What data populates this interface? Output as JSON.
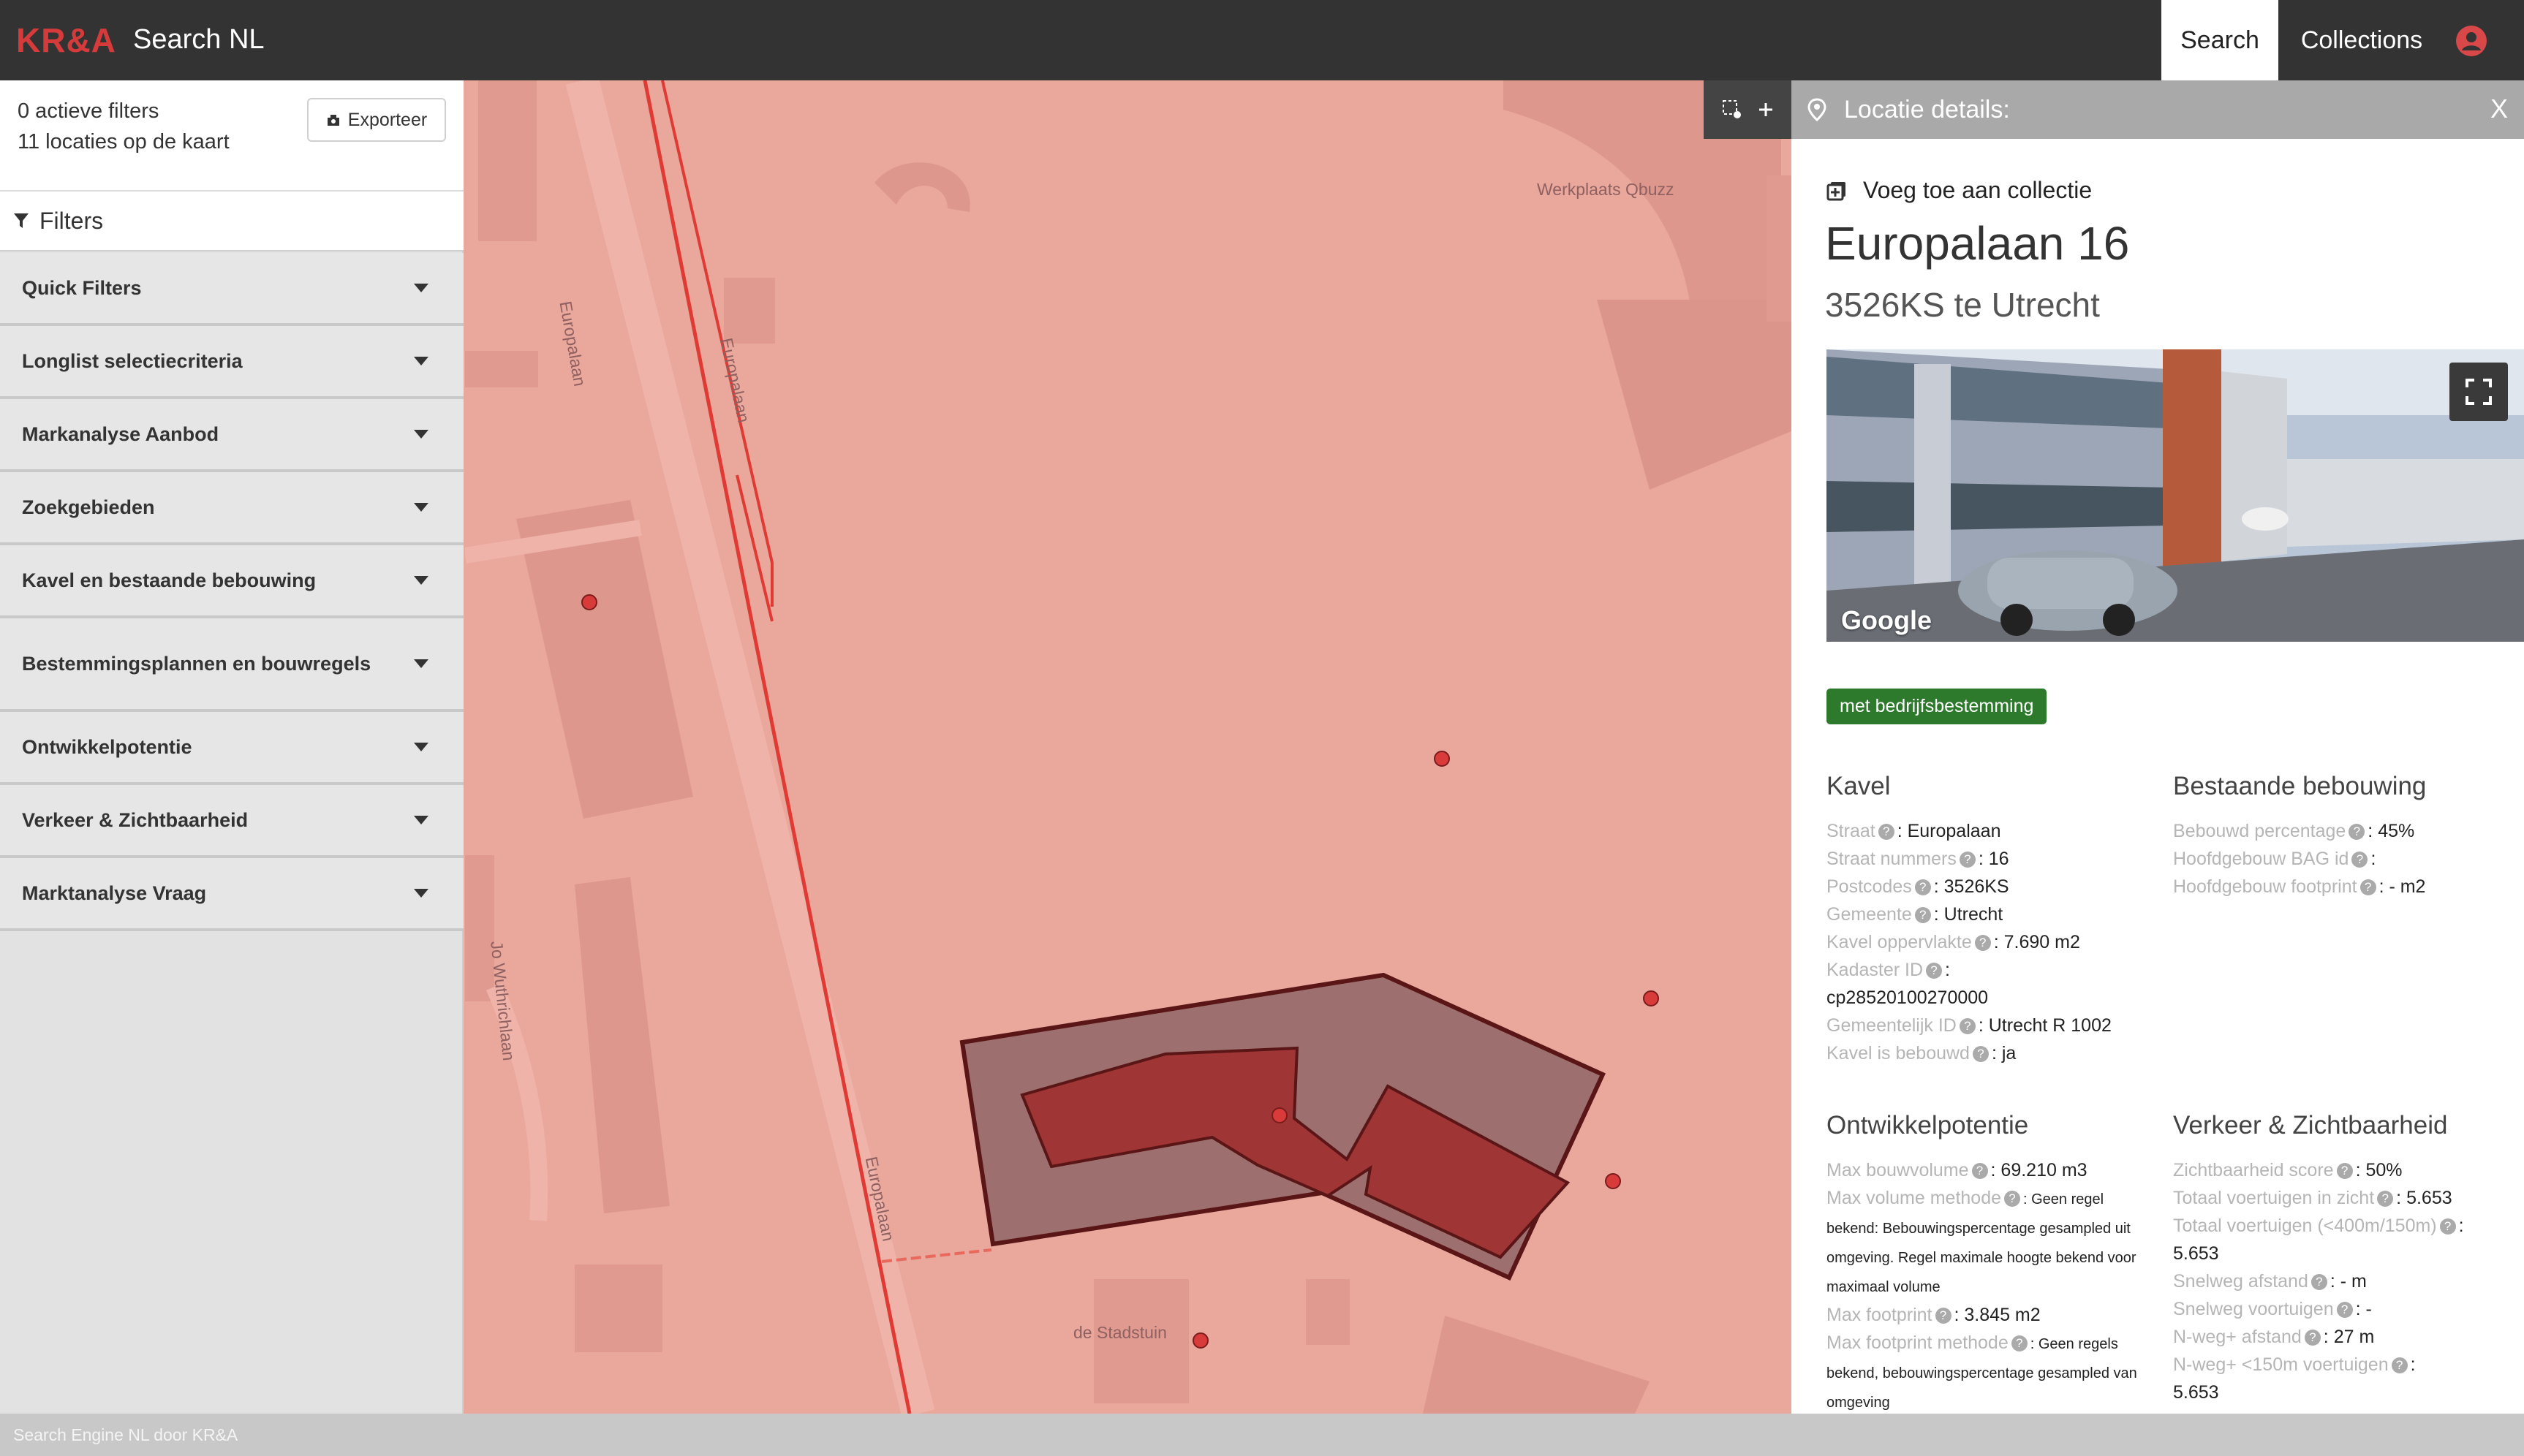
{
  "header": {
    "logo": "KR&A",
    "app_title": "Search NL",
    "nav": {
      "search": "Search",
      "collections": "Collections"
    }
  },
  "sidebar": {
    "summary": {
      "filters": "0 actieve filters",
      "locations": "11 locaties op de kaart"
    },
    "export_label": "Exporteer",
    "filters_title": "Filters",
    "items": [
      {
        "label": "Quick Filters"
      },
      {
        "label": "Longlist selectiecriteria"
      },
      {
        "label": "Markanalyse Aanbod"
      },
      {
        "label": "Zoekgebieden"
      },
      {
        "label": "Kavel en bestaande bebouwing"
      },
      {
        "label": "Bestemmingsplannen en bouwregels"
      },
      {
        "label": "Ontwikkelpotentie"
      },
      {
        "label": "Verkeer & Zichtbaarheid"
      },
      {
        "label": "Marktanalyse Vraag"
      }
    ]
  },
  "map": {
    "labels": {
      "europalaan_1": "Europalaan",
      "europalaan_2": "Europalaan",
      "europalaan_3": "Europalaan",
      "werkplaats": "Werkplaats Qbuzz",
      "jo_wuthrich": "Jo Wuthrichlaan",
      "stadstuin": "de Stadstuin"
    }
  },
  "panel": {
    "header_title": "Locatie details:",
    "close_label": "X",
    "add_to_collection": "Voeg toe aan collectie",
    "address_line1": "Europalaan 16",
    "address_line2": "3526KS te Utrecht",
    "photo_credit": "Google",
    "badge": "met bedrijfsbestemming",
    "kavel": {
      "title": "Kavel",
      "rows": [
        {
          "key": "Straat",
          "value": ": Europalaan"
        },
        {
          "key": "Straat nummers",
          "value": ": 16"
        },
        {
          "key": "Postcodes",
          "value": ": 3526KS"
        },
        {
          "key": "Gemeente",
          "value": ": Utrecht"
        },
        {
          "key": "Kavel oppervlakte",
          "value": ": 7.690 m2"
        },
        {
          "key": "Kadaster ID",
          "value": ":"
        },
        {
          "key": "",
          "value": "cp28520100270000"
        },
        {
          "key": "Gemeentelijk ID",
          "value": ": Utrecht R 1002"
        },
        {
          "key": "Kavel is bebouwd",
          "value": ": ja"
        }
      ]
    },
    "bebouwing": {
      "title": "Bestaande bebouwing",
      "rows": [
        {
          "key": "Bebouwd percentage",
          "value": ": 45%"
        },
        {
          "key": "Hoofdgebouw BAG id",
          "value": ":"
        },
        {
          "key": "Hoofdgebouw footprint",
          "value": ": - m2"
        }
      ]
    },
    "ontwikkel": {
      "title": "Ontwikkelpotentie",
      "max_bouwvolume_key": "Max bouwvolume",
      "max_bouwvolume_val": ": 69.210 m3",
      "max_volume_methode_key": "Max volume methode",
      "max_volume_methode_val": ": Geen regel bekend: Bebouwingspercentage gesampled uit omgeving. Regel maximale hoogte bekend voor maximaal volume",
      "max_footprint_key": "Max footprint",
      "max_footprint_val": ": 3.845 m2",
      "max_footprint_methode_key": "Max footprint methode",
      "max_footprint_methode_val": ": Geen regels bekend, bebouwingspercentage gesampled van omgeving"
    },
    "verkeer": {
      "title": "Verkeer & Zichtbaarheid",
      "rows": [
        {
          "key": "Zichtbaarheid score",
          "value": ": 50%"
        },
        {
          "key": "Totaal voertuigen in zicht",
          "value": ": 5.653"
        },
        {
          "key": "Totaal voertuigen (<400m/150m)",
          "value": ": 5.653"
        },
        {
          "key": "Snelweg afstand",
          "value": ": - m"
        },
        {
          "key": "Snelweg voortuigen",
          "value": ": -"
        },
        {
          "key": "N-weg+ afstand",
          "value": ": 27 m"
        },
        {
          "key": "N-weg+ <150m voertuigen",
          "value": ":"
        },
        {
          "key": "",
          "value": "5.653"
        }
      ]
    }
  },
  "footer": {
    "text": "Search Engine NL door KR&A"
  }
}
